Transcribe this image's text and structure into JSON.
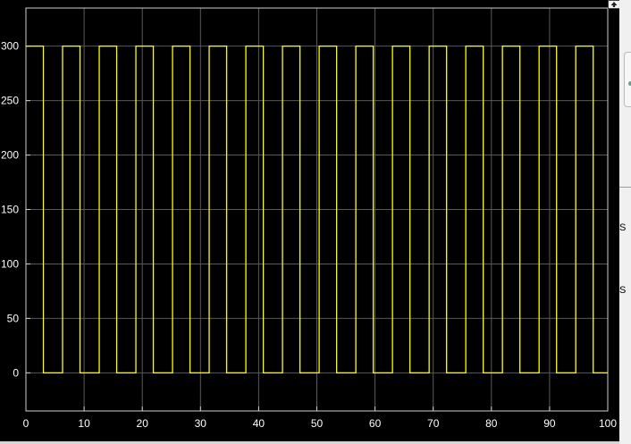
{
  "chart_data": {
    "type": "line",
    "title": "",
    "xlabel": "",
    "ylabel": "",
    "xlim": [
      0,
      100
    ],
    "ylim": [
      -35,
      335
    ],
    "xticks": [
      0,
      10,
      20,
      30,
      40,
      50,
      60,
      70,
      80,
      90,
      100
    ],
    "yticks": [
      0,
      50,
      100,
      150,
      200,
      250,
      300
    ],
    "grid": true,
    "background": "#000000",
    "series": [
      {
        "color": "#ffff00",
        "x": [
          0,
          3,
          3,
          6.3,
          6.3,
          9.3,
          9.3,
          12.6,
          12.6,
          15.6,
          15.6,
          18.9,
          18.9,
          21.9,
          21.9,
          25.2,
          25.2,
          28.2,
          28.2,
          31.5,
          31.5,
          34.5,
          34.5,
          37.8,
          37.8,
          40.8,
          40.8,
          44.1,
          44.1,
          47.1,
          47.1,
          50.4,
          50.4,
          53.4,
          53.4,
          56.7,
          56.7,
          59.7,
          59.7,
          63,
          63,
          66,
          66,
          69.3,
          69.3,
          72.3,
          72.3,
          75.6,
          75.6,
          78.6,
          78.6,
          81.9,
          81.9,
          84.9,
          84.9,
          88.2,
          88.2,
          91.2,
          91.2,
          94.5,
          94.5,
          97.5,
          97.5,
          100
        ],
        "y": [
          300,
          300,
          0,
          0,
          300,
          300,
          0,
          0,
          300,
          300,
          0,
          0,
          300,
          300,
          0,
          0,
          300,
          300,
          0,
          0,
          300,
          300,
          0,
          0,
          300,
          300,
          0,
          0,
          300,
          300,
          0,
          0,
          300,
          300,
          0,
          0,
          300,
          300,
          0,
          0,
          300,
          300,
          0,
          0,
          300,
          300,
          0,
          0,
          300,
          300,
          0,
          0,
          300,
          300,
          0,
          0,
          300,
          300,
          0,
          0,
          300,
          300,
          0,
          0
        ]
      }
    ]
  },
  "style": {
    "grid_color": "#5a5a5a",
    "axes_color": "#cfcfcf",
    "tick_label_color": "#ffffff"
  },
  "side_panel": {
    "text_rows": [
      "S",
      "S"
    ]
  }
}
